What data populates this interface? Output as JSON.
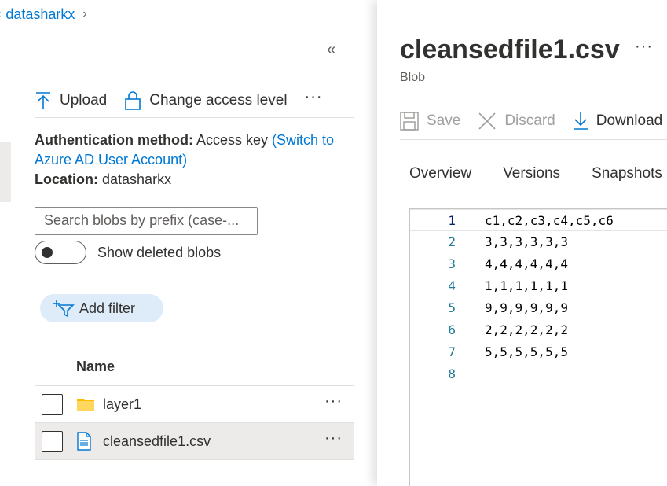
{
  "breadcrumb": {
    "item": "datasharkx"
  },
  "left": {
    "collapse_glyph": "«",
    "toolbar": {
      "upload_label": "Upload",
      "change_access_label": "Change access level",
      "more_label": "···"
    },
    "auth": {
      "label": "Authentication method:",
      "value": "Access key",
      "switch_link": "(Switch to Azure AD User Account)"
    },
    "location": {
      "label": "Location:",
      "value": "datasharkx"
    },
    "search": {
      "placeholder": "Search blobs by prefix (case-..."
    },
    "show_deleted": {
      "label": "Show deleted blobs",
      "on": false
    },
    "add_filter_label": "Add filter",
    "grid": {
      "header": "Name",
      "rows": [
        {
          "name": "layer1",
          "type": "folder",
          "more": "···"
        },
        {
          "name": "cleansedfile1.csv",
          "type": "file",
          "more": "···"
        }
      ]
    }
  },
  "right": {
    "title": "cleansedfile1.csv",
    "subtitle": "Blob",
    "more_label": "···",
    "toolbar": {
      "save_label": "Save",
      "discard_label": "Discard",
      "download_label": "Download"
    },
    "tabs": [
      "Overview",
      "Versions",
      "Snapshots"
    ],
    "editor": {
      "lines": [
        {
          "num": "1",
          "text": "c1,c2,c3,c4,c5,c6"
        },
        {
          "num": "2",
          "text": "3,3,3,3,3,3"
        },
        {
          "num": "3",
          "text": "4,4,4,4,4,4"
        },
        {
          "num": "4",
          "text": "1,1,1,1,1,1"
        },
        {
          "num": "5",
          "text": "9,9,9,9,9,9"
        },
        {
          "num": "6",
          "text": "2,2,2,2,2,2"
        },
        {
          "num": "7",
          "text": "5,5,5,5,5,5"
        },
        {
          "num": "8",
          "text": ""
        }
      ]
    }
  },
  "colors": {
    "accent": "#0078d4",
    "folder": "#ffb900",
    "selected_row": "#edebe9"
  }
}
